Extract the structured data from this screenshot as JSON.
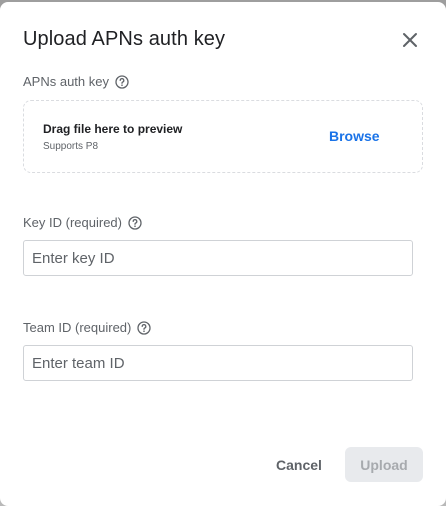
{
  "dialog": {
    "title": "Upload APNs auth key"
  },
  "auth_key": {
    "label": "APNs auth key",
    "drop_title": "Drag file here to preview",
    "drop_subtitle": "Supports P8",
    "browse_label": "Browse"
  },
  "key_id": {
    "label": "Key ID (required)",
    "value": "",
    "placeholder": "Enter key ID"
  },
  "team_id": {
    "label": "Team ID (required)",
    "value": "",
    "placeholder": "Enter team ID"
  },
  "actions": {
    "cancel_label": "Cancel",
    "upload_label": "Upload",
    "upload_enabled": false
  },
  "colors": {
    "accent": "#1a73e8",
    "title_text": "#202124",
    "secondary_text": "#5f6368",
    "disabled_bg": "#e8eaed"
  },
  "icons": {
    "close": "close-icon",
    "help": "help-circle-icon"
  }
}
